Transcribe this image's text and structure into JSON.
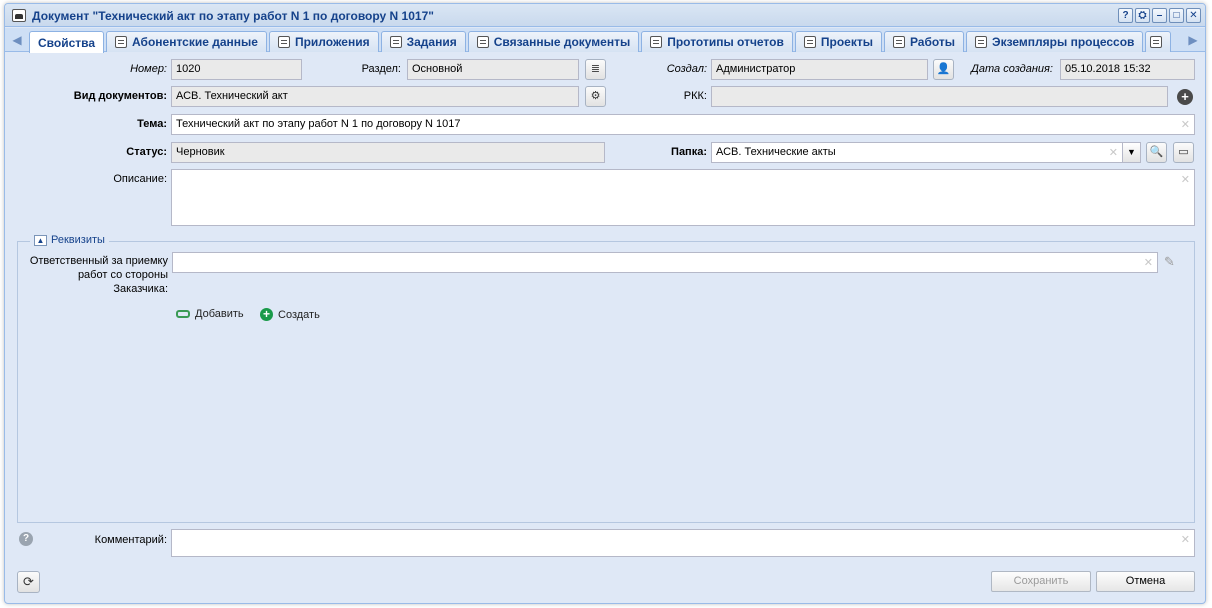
{
  "window": {
    "title": "Документ \"Технический акт по этапу работ N 1 по договору N 1017\"",
    "tools": [
      "?",
      "⛭",
      "–",
      "□",
      "✕"
    ]
  },
  "tabs": [
    {
      "label": "Свойства",
      "icon": "none",
      "active": true
    },
    {
      "label": "Абонентские данные",
      "icon": "contact-icon"
    },
    {
      "label": "Приложения",
      "icon": "attachment-icon"
    },
    {
      "label": "Задания",
      "icon": "task-icon"
    },
    {
      "label": "Связанные документы",
      "icon": "linked-docs-icon"
    },
    {
      "label": "Прототипы отчетов",
      "icon": "report-icon"
    },
    {
      "label": "Проекты",
      "icon": "projects-icon"
    },
    {
      "label": "Работы",
      "icon": "works-icon"
    },
    {
      "label": "Экземпляры процессов",
      "icon": "process-icon"
    }
  ],
  "form": {
    "number": {
      "label": "Номер:",
      "value": "1020"
    },
    "section": {
      "label": "Раздел:",
      "value": "Основной"
    },
    "created_by": {
      "label": "Создал:",
      "value": "Администратор"
    },
    "created_date": {
      "label": "Дата создания:",
      "value": "05.10.2018 15:32"
    },
    "doc_type": {
      "label": "Вид документов:",
      "value": "АСВ. Технический акт"
    },
    "rkk": {
      "label": "РКК:",
      "value": ""
    },
    "subject": {
      "label": "Тема:",
      "value": "Технический акт по этапу работ N 1 по договору N 1017"
    },
    "status": {
      "label": "Статус:",
      "value": "Черновик"
    },
    "folder": {
      "label": "Папка:",
      "value": "АСВ. Технические акты"
    },
    "description": {
      "label": "Описание:",
      "value": ""
    }
  },
  "requisites": {
    "legend": "Реквизиты",
    "responsible_label_1": "Ответственный за приемку",
    "responsible_label_2": "работ со стороны",
    "responsible_label_3": "Заказчика:",
    "responsible_value": "",
    "add_label": "Добавить",
    "create_label": "Создать"
  },
  "comment": {
    "label": "Комментарий:",
    "value": ""
  },
  "footer": {
    "save_label": "Сохранить",
    "cancel_label": "Отмена"
  }
}
